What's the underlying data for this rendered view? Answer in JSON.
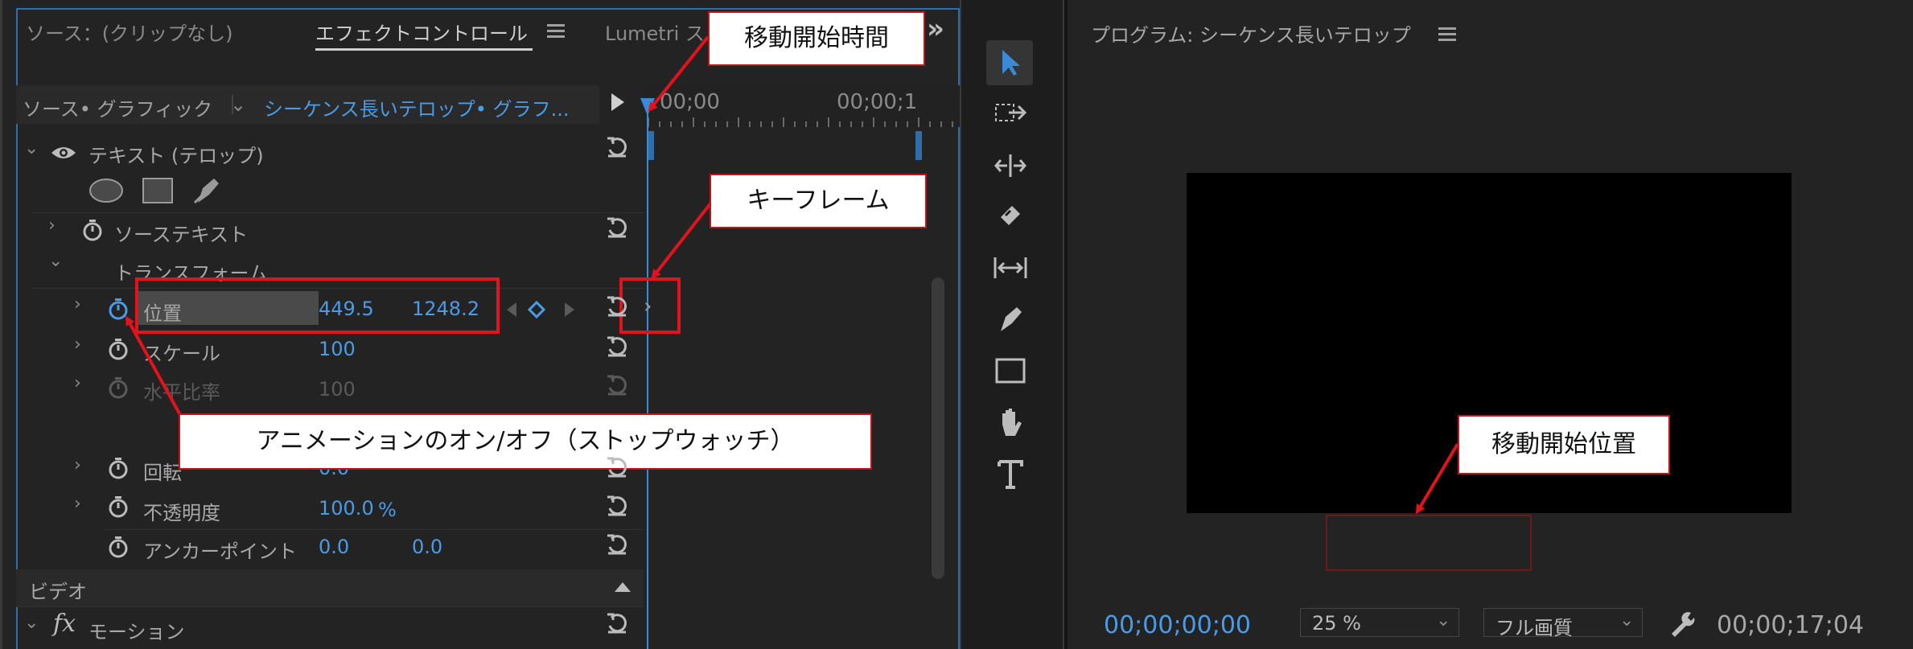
{
  "colors": {
    "accent_blue": "#4a9be8",
    "annotation_red": "#e1131c",
    "panel_bg": "#232323"
  },
  "left_panel": {
    "tabs": {
      "source": "ソース：(クリップなし)",
      "effect_controls": "エフェクトコントロール",
      "lumetri": "Lumetri ス"
    },
    "overflow_label": "»",
    "source_bar": {
      "source_label": "ソース• グラフィック",
      "sequence_label": "シーケンス長いテロップ• グラフ...",
      "play_icon": "play-triangle-icon"
    },
    "ruler": {
      "start_time": "00;00",
      "end_time": "00;00;1"
    },
    "text_section": {
      "title": "テキスト (テロップ)"
    },
    "shape_tools": [
      "ellipse-icon",
      "rectangle-icon",
      "pen-icon"
    ],
    "properties": {
      "source_text": {
        "label": "ソーステキスト"
      },
      "transform": {
        "label": "トランスフォーム"
      },
      "position": {
        "label": "位置",
        "x": "449.5",
        "y": "1248.2"
      },
      "scale": {
        "label": "スケール",
        "value": "100"
      },
      "horizontal_ratio": {
        "label": "水平比率",
        "value": "100"
      },
      "rotation": {
        "label": "回転",
        "value": "0.0"
      },
      "opacity": {
        "label": "不透明度",
        "value": "100.0",
        "unit": "%"
      },
      "anchor": {
        "label": "アンカーポイント",
        "x": "0.0",
        "y": "0.0"
      }
    },
    "video_section": {
      "label": "ビデオ"
    },
    "motion": {
      "fx": "fx",
      "label": "モーション"
    }
  },
  "program": {
    "title": "プログラム: シーケンス長いテロップ",
    "timecode_current": "00;00;00;00",
    "zoom": "25 %",
    "quality": "フル画質",
    "timecode_duration": "00;00;17;04"
  },
  "annotations": {
    "start_time": "移動開始時間",
    "keyframe": "キーフレーム",
    "stopwatch": "アニメーションのオン/オフ（ストップウォッチ）",
    "start_position": "移動開始位置"
  }
}
